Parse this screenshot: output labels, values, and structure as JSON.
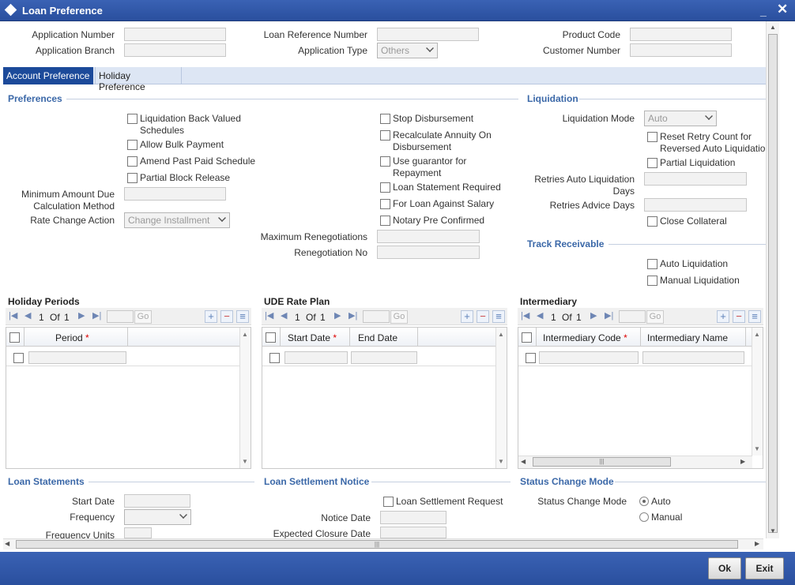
{
  "window": {
    "title": "Loan Preference"
  },
  "header": {
    "application_number": "Application Number",
    "application_branch": "Application Branch",
    "loan_reference_number": "Loan Reference Number",
    "application_type": "Application Type",
    "application_type_value": "Others",
    "product_code": "Product Code",
    "customer_number": "Customer Number"
  },
  "tabs": [
    {
      "label": "Account Preference"
    },
    {
      "label": "Holiday Preference"
    }
  ],
  "preferences": {
    "title": "Preferences",
    "liquidation_back_valued_1": "Liquidation Back Valued",
    "liquidation_back_valued_2": "Schedules",
    "allow_bulk_payment": "Allow Bulk Payment",
    "amend_past_paid_schedule": "Amend Past Paid Schedule",
    "partial_block_release": "Partial Block Release",
    "min_amount_due_1": "Minimum Amount Due",
    "min_amount_due_2": "Calculation Method",
    "rate_change_action": "Rate Change Action",
    "rate_change_action_value": "Change Installment",
    "stop_disbursement": "Stop Disbursement",
    "recalculate_annuity_1": "Recalculate Annuity On",
    "recalculate_annuity_2": "Disbursement",
    "use_guarantor_1": "Use guarantor for",
    "use_guarantor_2": "Repayment",
    "loan_statement_required": "Loan Statement Required",
    "for_loan_against_salary": "For Loan Against Salary",
    "notary_pre_confirmed": "Notary Pre Confirmed",
    "maximum_renegotiations": "Maximum Renegotiations",
    "renegotiation_no": "Renegotiation No"
  },
  "liquidation": {
    "title": "Liquidation",
    "mode_label": "Liquidation Mode",
    "mode_value": "Auto",
    "reset_retry_1": "Reset Retry Count for",
    "reset_retry_2": "Reversed Auto Liquidation",
    "partial_liquidation": "Partial Liquidation",
    "retries_auto_1": "Retries Auto Liquidation",
    "retries_auto_2": "Days",
    "retries_advice": "Retries Advice Days",
    "close_collateral": "Close Collateral"
  },
  "track_receivable": {
    "title": "Track Receivable",
    "auto_liquidation": "Auto Liquidation",
    "manual_liquidation": "Manual Liquidation"
  },
  "grids": {
    "holiday": {
      "title": "Holiday Periods",
      "page": "1",
      "of": "Of",
      "total": "1",
      "go": "Go",
      "col1": "Period"
    },
    "ude": {
      "title": "UDE Rate Plan",
      "page": "1",
      "of": "Of",
      "total": "1",
      "go": "Go",
      "col1": "Start Date",
      "col2": "End Date"
    },
    "intermediary": {
      "title": "Intermediary",
      "page": "1",
      "of": "Of",
      "total": "1",
      "go": "Go",
      "col1": "Intermediary Code",
      "col2": "Intermediary Name"
    }
  },
  "loan_statements": {
    "title": "Loan Statements",
    "start_date": "Start Date",
    "frequency": "Frequency",
    "frequency_units": "Frequency Units"
  },
  "loan_settlement": {
    "title": "Loan Settlement Notice",
    "request": "Loan Settlement Request",
    "notice_date": "Notice Date",
    "expected_closure": "Expected Closure Date"
  },
  "status_change": {
    "title": "Status Change Mode",
    "label": "Status Change Mode",
    "auto": "Auto",
    "manual": "Manual"
  },
  "footer": {
    "ok": "Ok",
    "exit": "Exit"
  },
  "symbols": {
    "required": "*",
    "plus": "+",
    "minus": "−",
    "list": "≡",
    "first": "|◀",
    "prev": "◀",
    "next": "▶",
    "last": "▶|",
    "scroll_grip": "|||",
    "scroll_up": "▲",
    "scroll_down": "▼",
    "scroll_left": "◀",
    "scroll_right": "▶"
  }
}
